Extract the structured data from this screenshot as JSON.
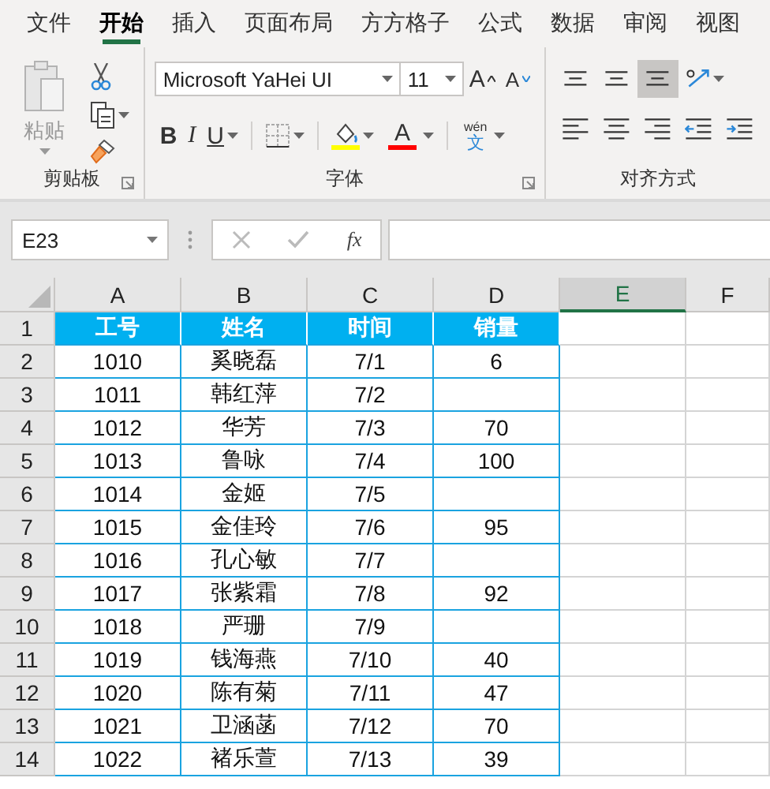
{
  "menu_tabs": [
    {
      "label": "文件",
      "selected": false
    },
    {
      "label": "开始",
      "selected": true
    },
    {
      "label": "插入",
      "selected": false
    },
    {
      "label": "页面布局",
      "selected": false
    },
    {
      "label": "方方格子",
      "selected": false
    },
    {
      "label": "公式",
      "selected": false
    },
    {
      "label": "数据",
      "selected": false
    },
    {
      "label": "审阅",
      "selected": false
    },
    {
      "label": "视图",
      "selected": false
    }
  ],
  "ribbon": {
    "clipboard": {
      "paste_label": "粘贴",
      "group_label": "剪贴板"
    },
    "font": {
      "font_name": "Microsoft YaHei UI",
      "font_size": "11",
      "grow": "A",
      "shrink": "A",
      "bold": "B",
      "italic": "I",
      "underline": "U",
      "font_color": "A",
      "phonetic_top": "wén",
      "phonetic_char": "文",
      "group_label": "字体"
    },
    "alignment": {
      "group_label": "对齐方式",
      "buttons": [
        {
          "kind": "top",
          "selected": false
        },
        {
          "kind": "middle",
          "selected": false
        },
        {
          "kind": "bottom",
          "selected": true
        },
        {
          "kind": "orientation",
          "selected": false
        },
        {
          "kind": "left",
          "selected": false
        },
        {
          "kind": "center",
          "selected": false
        },
        {
          "kind": "right",
          "selected": false
        },
        {
          "kind": "outdent",
          "selected": false
        },
        {
          "kind": "indent",
          "selected": false
        }
      ]
    }
  },
  "formula_bar": {
    "name_box": "E23",
    "function_label": "fx"
  },
  "sheet": {
    "columns": [
      {
        "label": "A",
        "selected": false
      },
      {
        "label": "B",
        "selected": false
      },
      {
        "label": "C",
        "selected": false
      },
      {
        "label": "D",
        "selected": false
      },
      {
        "label": "E",
        "selected": true
      },
      {
        "label": "F",
        "selected": false
      }
    ],
    "rows": [
      {
        "number": "1",
        "kind": "header",
        "cells": [
          "工号",
          "姓名",
          "时间",
          "销量"
        ]
      },
      {
        "number": "2",
        "kind": "data",
        "cells": [
          "1010",
          "奚晓磊",
          "7/1",
          "6"
        ]
      },
      {
        "number": "3",
        "kind": "data",
        "cells": [
          "1011",
          "韩红萍",
          "7/2",
          null
        ]
      },
      {
        "number": "4",
        "kind": "data",
        "cells": [
          "1012",
          "华芳",
          "7/3",
          "70"
        ]
      },
      {
        "number": "5",
        "kind": "data",
        "cells": [
          "1013",
          "鲁咏",
          "7/4",
          "100"
        ]
      },
      {
        "number": "6",
        "kind": "data",
        "cells": [
          "1014",
          "金姬",
          "7/5",
          null
        ]
      },
      {
        "number": "7",
        "kind": "data",
        "cells": [
          "1015",
          "金佳玲",
          "7/6",
          "95"
        ]
      },
      {
        "number": "8",
        "kind": "data",
        "cells": [
          "1016",
          "孔心敏",
          "7/7",
          null
        ]
      },
      {
        "number": "9",
        "kind": "data",
        "cells": [
          "1017",
          "张紫霜",
          "7/8",
          "92"
        ]
      },
      {
        "number": "10",
        "kind": "data",
        "cells": [
          "1018",
          "严珊",
          "7/9",
          null
        ]
      },
      {
        "number": "11",
        "kind": "data",
        "cells": [
          "1019",
          "钱海燕",
          "7/10",
          "40"
        ]
      },
      {
        "number": "12",
        "kind": "data",
        "cells": [
          "1020",
          "陈有菊",
          "7/11",
          "47"
        ]
      },
      {
        "number": "13",
        "kind": "data",
        "cells": [
          "1021",
          "卫涵菡",
          "7/12",
          "70"
        ]
      },
      {
        "number": "14",
        "kind": "data",
        "cells": [
          "1022",
          "褚乐萱",
          "7/13",
          "39"
        ]
      }
    ]
  }
}
